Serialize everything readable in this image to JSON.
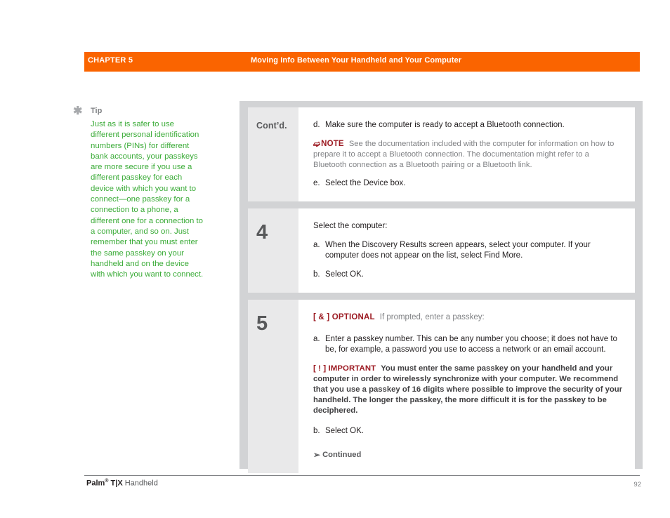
{
  "header": {
    "chapter": "CHAPTER 5",
    "title": "Moving Info Between Your Handheld and Your Computer",
    "bar_color": "#fa6400"
  },
  "tip": {
    "icon": "asterisk-icon",
    "label": "Tip",
    "body": "Just as it is safer to use different personal identification numbers (PINs) for different bank accounts, your passkeys are more secure if you use a different passkey for each device with which you want to connect—one passkey for a connection to a phone, a different one for a connection to a computer, and so on. Just remember that you must enter the same passkey on your handheld and on the device with which you want to connect.",
    "text_color": "#3aab37"
  },
  "steps": [
    {
      "number": "Cont’d.",
      "number_style": "word",
      "items": [
        {
          "kind": "sub",
          "letter": "d.",
          "text": "Make sure the computer is ready to accept a Bluetooth connection."
        },
        {
          "kind": "note",
          "icon": "note-flag-icon",
          "label": "NOTE",
          "text": "See the documentation included with the computer for information on how to prepare it to accept a Bluetooth connection. The documentation might refer to a Bluetooth connection as a Bluetooth pairing or a Bluetooth link."
        },
        {
          "kind": "sub",
          "letter": "e.",
          "text": "Select the Device box."
        }
      ]
    },
    {
      "number": "4",
      "number_style": "digit",
      "items": [
        {
          "kind": "para",
          "text": "Select the computer:"
        },
        {
          "kind": "sub",
          "letter": "a.",
          "text": "When the Discovery Results screen appears, select your computer. If your computer does not appear on the list, select Find More."
        },
        {
          "kind": "sub",
          "letter": "b.",
          "text": "Select OK."
        }
      ]
    },
    {
      "number": "5",
      "number_style": "digit",
      "items": [
        {
          "kind": "optional",
          "tag": "[ & ]  OPTIONAL",
          "text": "If prompted, enter a passkey:"
        },
        {
          "kind": "sub",
          "letter": "a.",
          "text": "Enter a passkey number. This can be any number you choose; it does not have to be, for example, a password you use to access a network or an email account."
        },
        {
          "kind": "important",
          "tag": "[ ! ] IMPORTANT",
          "text": "You must enter the same passkey on your handheld and your computer in order to wirelessly synchronize with your computer. We recommend that you use a passkey of 16 digits where possible to improve the security of your handheld. The longer the passkey, the more difficult it is for the passkey to be deciphered."
        },
        {
          "kind": "sub",
          "letter": "b.",
          "text": "Select OK."
        },
        {
          "kind": "continued",
          "icon": "arrow-down-right-icon",
          "text": "Continued"
        }
      ]
    }
  ],
  "footer": {
    "brand": "Palm",
    "registered": "®",
    "model": " T|X",
    "product": " Handheld",
    "page_number": "92"
  }
}
